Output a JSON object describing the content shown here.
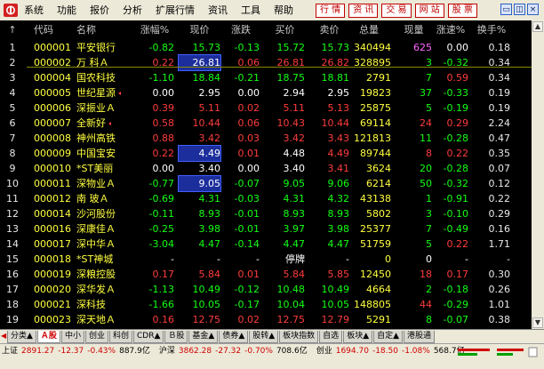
{
  "menubar": {
    "items": [
      "系统",
      "功能",
      "报价",
      "分析",
      "扩展行情",
      "资讯",
      "工具",
      "帮助"
    ],
    "nav_buttons": [
      "行 情",
      "资 讯",
      "交 易",
      "网 站",
      "股 票"
    ],
    "window_controls": {
      "minimize": "▭",
      "restore": "◫",
      "close": "×"
    }
  },
  "table": {
    "headers": [
      "代码",
      "名称",
      "涨幅%",
      "现价",
      "涨跌",
      "买价",
      "卖价",
      "总量",
      "现量",
      "涨速%",
      "换手%"
    ],
    "rows": [
      {
        "num": "1",
        "code": "000001",
        "name": "平安银行",
        "mark": false,
        "chg": "-0.82",
        "price": "15.73",
        "diff": "-0.13",
        "bid": "15.72",
        "ask": "15.73",
        "vol": "340494",
        "cur": "625",
        "spd": "0.00",
        "turn": "0.18",
        "c": {
          "chg": "green",
          "price": "green",
          "diff": "green",
          "bid": "green",
          "ask": "green",
          "cur": "magenta",
          "spd": "white"
        }
      },
      {
        "num": "2",
        "code": "000002",
        "name": "万 科Ａ",
        "mark": false,
        "chg": "0.22",
        "price": "26.81",
        "diff": "0.06",
        "bid": "26.81",
        "ask": "26.82",
        "vol": "328895",
        "cur": "3",
        "spd": "-0.32",
        "turn": "0.34",
        "hl_price": true,
        "c": {
          "chg": "red",
          "price": "white",
          "diff": "red",
          "bid": "red",
          "ask": "red",
          "cur": "green",
          "spd": "green"
        }
      },
      {
        "num": "3",
        "code": "000004",
        "name": "国农科技",
        "mark": false,
        "chg": "-1.10",
        "price": "18.84",
        "diff": "-0.21",
        "bid": "18.75",
        "ask": "18.81",
        "vol": "2791",
        "cur": "7",
        "spd": "0.59",
        "turn": "0.34",
        "c": {
          "chg": "green",
          "price": "green",
          "diff": "green",
          "bid": "green",
          "ask": "green",
          "cur": "green",
          "spd": "red"
        }
      },
      {
        "num": "4",
        "code": "000005",
        "name": "世纪星源",
        "mark": true,
        "chg": "0.00",
        "price": "2.95",
        "diff": "0.00",
        "bid": "2.94",
        "ask": "2.95",
        "vol": "19823",
        "cur": "37",
        "spd": "-0.33",
        "turn": "0.19",
        "c": {
          "chg": "white",
          "price": "white",
          "diff": "white",
          "bid": "white",
          "ask": "white",
          "cur": "green",
          "spd": "green"
        }
      },
      {
        "num": "5",
        "code": "000006",
        "name": "深振业Ａ",
        "mark": false,
        "chg": "0.39",
        "price": "5.11",
        "diff": "0.02",
        "bid": "5.11",
        "ask": "5.13",
        "vol": "25875",
        "cur": "5",
        "spd": "-0.19",
        "turn": "0.19",
        "c": {
          "chg": "red",
          "price": "red",
          "diff": "red",
          "bid": "red",
          "ask": "red",
          "cur": "green",
          "spd": "green"
        }
      },
      {
        "num": "6",
        "code": "000007",
        "name": "全新好",
        "mark": true,
        "chg": "0.58",
        "price": "10.44",
        "diff": "0.06",
        "bid": "10.43",
        "ask": "10.44",
        "vol": "69114",
        "cur": "24",
        "spd": "0.29",
        "turn": "2.24",
        "c": {
          "chg": "red",
          "price": "red",
          "diff": "red",
          "bid": "red",
          "ask": "red",
          "cur": "red",
          "spd": "red"
        }
      },
      {
        "num": "7",
        "code": "000008",
        "name": "神州高铁",
        "mark": false,
        "chg": "0.88",
        "price": "3.42",
        "diff": "0.03",
        "bid": "3.42",
        "ask": "3.43",
        "vol": "121813",
        "cur": "11",
        "spd": "-0.28",
        "turn": "0.47",
        "c": {
          "chg": "red",
          "price": "red",
          "diff": "red",
          "bid": "red",
          "ask": "red",
          "cur": "green",
          "spd": "green"
        }
      },
      {
        "num": "8",
        "code": "000009",
        "name": "中国宝安",
        "mark": false,
        "chg": "0.22",
        "price": "4.49",
        "diff": "0.01",
        "bid": "4.48",
        "ask": "4.49",
        "vol": "89744",
        "cur": "8",
        "spd": "0.22",
        "turn": "0.35",
        "hl_price": true,
        "c": {
          "chg": "red",
          "price": "white",
          "diff": "red",
          "bid": "white",
          "ask": "red",
          "cur": "red",
          "spd": "red"
        }
      },
      {
        "num": "9",
        "code": "000010",
        "name": "*ST美丽",
        "mark": false,
        "chg": "0.00",
        "price": "3.40",
        "diff": "0.00",
        "bid": "3.40",
        "ask": "3.41",
        "vol": "3624",
        "cur": "20",
        "spd": "-0.28",
        "turn": "0.07",
        "c": {
          "chg": "white",
          "price": "white",
          "diff": "white",
          "bid": "white",
          "ask": "red",
          "cur": "green",
          "spd": "green"
        }
      },
      {
        "num": "10",
        "code": "000011",
        "name": "深物业Ａ",
        "mark": false,
        "chg": "-0.77",
        "price": "9.05",
        "diff": "-0.07",
        "bid": "9.05",
        "ask": "9.06",
        "vol": "6214",
        "cur": "50",
        "spd": "-0.32",
        "turn": "0.12",
        "hl_price": true,
        "c": {
          "chg": "green",
          "price": "white",
          "diff": "green",
          "bid": "green",
          "ask": "green",
          "cur": "green",
          "spd": "green"
        }
      },
      {
        "num": "11",
        "code": "000012",
        "name": "南 玻Ａ",
        "mark": false,
        "chg": "-0.69",
        "price": "4.31",
        "diff": "-0.03",
        "bid": "4.31",
        "ask": "4.32",
        "vol": "43138",
        "cur": "1",
        "spd": "-0.91",
        "turn": "0.22",
        "c": {
          "chg": "green",
          "price": "green",
          "diff": "green",
          "bid": "green",
          "ask": "green",
          "cur": "green",
          "spd": "green"
        }
      },
      {
        "num": "12",
        "code": "000014",
        "name": "沙河股份",
        "mark": false,
        "chg": "-0.11",
        "price": "8.93",
        "diff": "-0.01",
        "bid": "8.93",
        "ask": "8.93",
        "vol": "5802",
        "cur": "3",
        "spd": "-0.10",
        "turn": "0.29",
        "c": {
          "chg": "green",
          "price": "green",
          "diff": "green",
          "bid": "green",
          "ask": "green",
          "cur": "green",
          "spd": "green"
        }
      },
      {
        "num": "13",
        "code": "000016",
        "name": "深康佳Ａ",
        "mark": false,
        "chg": "-0.25",
        "price": "3.98",
        "diff": "-0.01",
        "bid": "3.97",
        "ask": "3.98",
        "vol": "25377",
        "cur": "7",
        "spd": "-0.49",
        "turn": "0.16",
        "c": {
          "chg": "green",
          "price": "green",
          "diff": "green",
          "bid": "green",
          "ask": "green",
          "cur": "green",
          "spd": "green"
        }
      },
      {
        "num": "14",
        "code": "000017",
        "name": "深中华Ａ",
        "mark": false,
        "chg": "-3.04",
        "price": "4.47",
        "diff": "-0.14",
        "bid": "4.47",
        "ask": "4.47",
        "vol": "51759",
        "cur": "5",
        "spd": "0.22",
        "turn": "1.71",
        "c": {
          "chg": "green",
          "price": "green",
          "diff": "green",
          "bid": "green",
          "ask": "green",
          "cur": "green",
          "spd": "red"
        }
      },
      {
        "num": "15",
        "code": "000018",
        "name": "*ST神城",
        "mark": false,
        "chg": "-",
        "price": "-",
        "diff": "-",
        "bid": "停牌",
        "ask": "-",
        "vol": "0",
        "cur": "0",
        "spd": "-",
        "turn": "-",
        "c": {
          "chg": "white",
          "price": "white",
          "diff": "white",
          "bid": "white",
          "ask": "white",
          "cur": "white",
          "spd": "white"
        }
      },
      {
        "num": "16",
        "code": "000019",
        "name": "深粮控股",
        "mark": false,
        "chg": "0.17",
        "price": "5.84",
        "diff": "0.01",
        "bid": "5.84",
        "ask": "5.85",
        "vol": "12450",
        "cur": "18",
        "spd": "0.17",
        "turn": "0.30",
        "c": {
          "chg": "red",
          "price": "red",
          "diff": "red",
          "bid": "red",
          "ask": "red",
          "cur": "red",
          "spd": "red"
        }
      },
      {
        "num": "17",
        "code": "000020",
        "name": "深华发Ａ",
        "mark": false,
        "chg": "-1.13",
        "price": "10.49",
        "diff": "-0.12",
        "bid": "10.48",
        "ask": "10.49",
        "vol": "4664",
        "cur": "2",
        "spd": "-0.18",
        "turn": "0.26",
        "c": {
          "chg": "green",
          "price": "green",
          "diff": "green",
          "bid": "green",
          "ask": "green",
          "cur": "green",
          "spd": "green"
        }
      },
      {
        "num": "18",
        "code": "000021",
        "name": "深科技",
        "mark": false,
        "chg": "-1.66",
        "price": "10.05",
        "diff": "-0.17",
        "bid": "10.04",
        "ask": "10.05",
        "vol": "148805",
        "cur": "44",
        "spd": "-0.29",
        "turn": "1.01",
        "c": {
          "chg": "green",
          "price": "green",
          "diff": "green",
          "bid": "green",
          "ask": "green",
          "cur": "red",
          "spd": "green"
        }
      },
      {
        "num": "19",
        "code": "000023",
        "name": "深天地Ａ",
        "mark": false,
        "chg": "0.16",
        "price": "12.75",
        "diff": "0.02",
        "bid": "12.75",
        "ask": "12.79",
        "vol": "5291",
        "cur": "8",
        "spd": "-0.07",
        "turn": "0.38",
        "c": {
          "chg": "red",
          "price": "red",
          "diff": "red",
          "bid": "red",
          "ask": "red",
          "cur": "green",
          "spd": "green"
        }
      }
    ]
  },
  "tabs": {
    "items": [
      "分类▲",
      "Ａ股",
      "中小",
      "创业",
      "科创",
      "CDR▲",
      "Ｂ股",
      "基金▲",
      "债券▲",
      "股转▲",
      "板块指数",
      "自选",
      "板块▲",
      "自定▲",
      "港股通"
    ],
    "active_index": 1
  },
  "statusbar": {
    "indices": [
      {
        "name": "上证",
        "val": "2891.27",
        "chg": "-12.37",
        "pct": "-0.43%",
        "amt": "887.9亿"
      },
      {
        "name": "沪深",
        "val": "3862.28",
        "chg": "-27.32",
        "pct": "-0.70%",
        "amt": "708.6亿"
      },
      {
        "name": "创业",
        "val": "1694.70",
        "chg": "-18.50",
        "pct": "-1.08%",
        "amt": "568.7亿"
      }
    ]
  }
}
